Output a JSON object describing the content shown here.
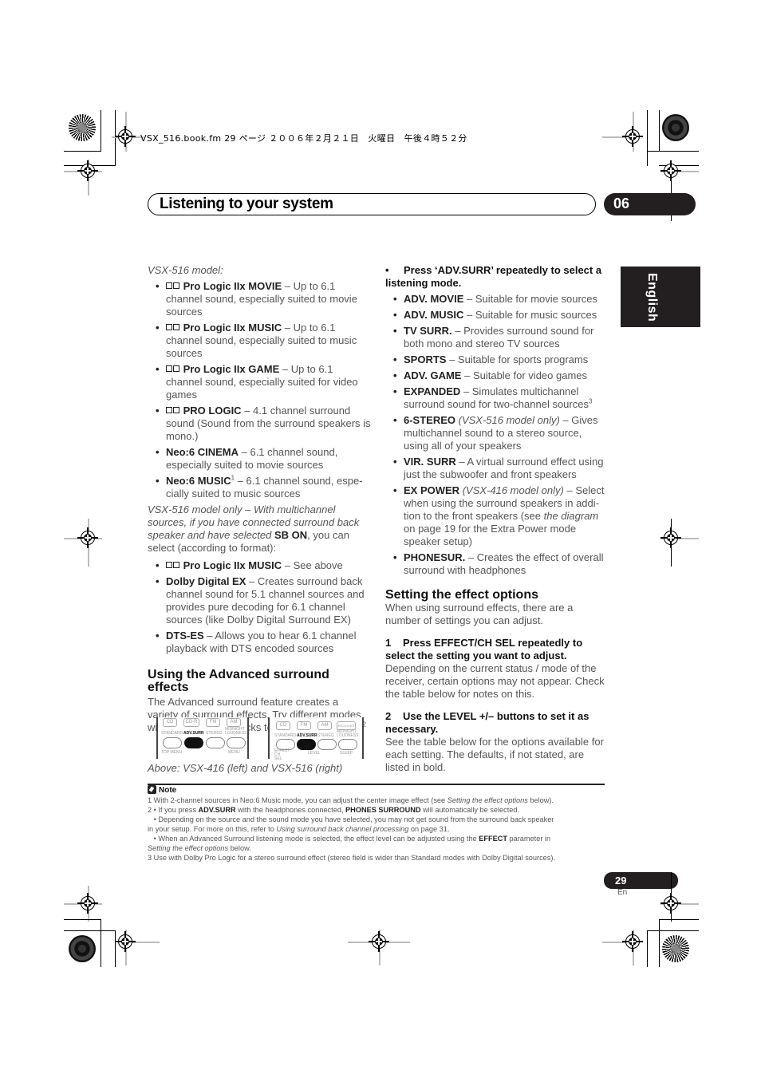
{
  "print_meta": "VSX_516.book.fm  29 ページ  ２００６年２月２１日　火曜日　午後４時５２分",
  "header": {
    "title": "Listening to your system",
    "chapter": "06"
  },
  "language_tab": "English",
  "left_column": {
    "intro_label": "VSX-516 model:",
    "modes": [
      {
        "name": "Pro Logic IIx MOVIE",
        "dolby_logo": true,
        "desc": " – Up to 6.1 channel sound, especially suited to movie sources"
      },
      {
        "name": "Pro Logic IIx MUSIC",
        "dolby_logo": true,
        "desc": " – Up to 6.1 channel sound, especially suited to music sources"
      },
      {
        "name": "Pro Logic IIx GAME",
        "dolby_logo": true,
        "desc": " – Up to 6.1 channel sound, especially suited for video games"
      },
      {
        "name": "PRO LOGIC",
        "dolby_logo": true,
        "desc": " – 4.1 channel surround sound (Sound from the surround speakers is mono.)"
      },
      {
        "name": "Neo:6 CINEMA",
        "dolby_logo": false,
        "desc": " – 6.1 channel sound, especially suited to movie sources"
      },
      {
        "name": "Neo:6 MUSIC",
        "dolby_logo": false,
        "sup": "1",
        "desc": " – 6.1 channel sound, espe-cially suited to music sources"
      }
    ],
    "sb_intro_italic": "VSX-516 model only – With multichannel sources, if you have connected surround back speaker and have selected ",
    "sb_intro_bold": "SB ON",
    "sb_intro_tail": ", you can select (according to format):",
    "sb_modes": [
      {
        "name": "Pro Logic IIx MUSIC",
        "dolby_logo": true,
        "desc": " – See above"
      },
      {
        "name": "Dolby Digital EX",
        "dolby_logo": false,
        "desc": " – Creates surround back channel sound for 5.1 channel sources and provides pure decoding for 6.1 channel sources (like Dolby Digital Surround EX)"
      },
      {
        "name": "DTS-ES",
        "dolby_logo": false,
        "desc": " – Allows you to hear 6.1 channel playback with DTS encoded sources"
      }
    ],
    "adv_heading": "Using the Advanced surround effects",
    "adv_body": "The Advanced surround feature creates a variety of surround effects. Try different modes with various soundtracks to see which you like.",
    "adv_body_sup": "2",
    "remote_416": {
      "top_buttons": [
        "CD",
        "CD-R",
        "FM",
        "AM"
      ],
      "labels": [
        "STANDARD",
        "ADV.SURR",
        "STEREO",
        "MIDNIGHT LOUDNESS"
      ],
      "bottom_labels": [
        "TOP MENU",
        "MENU"
      ]
    },
    "remote_516": {
      "top_buttons": [
        "CD",
        "FM",
        "AM",
        "RECEIVER"
      ],
      "labels": [
        "STANDARD",
        "ADV.SURR",
        "STEREO",
        "MIDNIGHT LOUDNESS"
      ],
      "bottom_labels": [
        "EFFECT CH SEL",
        "LEVEL",
        "SLEEP"
      ]
    },
    "caption": "Above: VSX-416 (left) and VSX-516 (right)"
  },
  "right_column": {
    "instruction": "Press ‘ADV.SURR’ repeatedly to select a listening mode.",
    "modes": [
      {
        "name": "ADV. MOVIE",
        "desc": " – Suitable for movie sources"
      },
      {
        "name": "ADV. MUSIC",
        "desc": " – Suitable for music sources"
      },
      {
        "name": "TV SURR.",
        "desc": " – Provides surround sound for both mono and stereo TV sources"
      },
      {
        "name": "SPORTS",
        "desc": " – Suitable for sports programs"
      },
      {
        "name": "ADV. GAME",
        "desc": " – Suitable for video games"
      },
      {
        "name": "EXPANDED",
        "desc": " – Simulates multichannel surround sound for two-channel sources",
        "sup": "3"
      },
      {
        "name": "6-STEREO",
        "italic": " (VSX-516 model only)",
        "desc": " – Gives multichannel sound to a stereo source, using all of your speakers"
      },
      {
        "name": "VIR. SURR",
        "desc": " – A virtual surround effect using just the subwoofer and front speakers"
      },
      {
        "name": "EX POWER",
        "italic": " (VSX-416 model only)",
        "desc": " – Select when using the surround speakers in addi-tion to the front speakers (see ",
        "desc_italic": "the diagram",
        "desc_tail": " on page 19 for the Extra Power mode speaker setup)"
      },
      {
        "name": "PHONESUR.",
        "desc": " – Creates the effect of overall surround with headphones"
      }
    ],
    "effect_heading": "Setting the effect options",
    "effect_body": "When using surround effects, there are a number of settings you can adjust.",
    "steps": [
      {
        "num": "1",
        "title": "Press EFFECT/CH SEL repeatedly to select the setting you want to adjust.",
        "body": "Depending on the current status / mode of the receiver, certain options may not appear. Check the table below for notes on this."
      },
      {
        "num": "2",
        "title": "Use the LEVEL +/– buttons to set it as necessary.",
        "body": "See the table below for the options available for each setting. The defaults, if not stated, are listed in bold."
      }
    ]
  },
  "notes": {
    "heading": "Note",
    "n1": {
      "pre": "1 With 2-channel sources in Neo:6 Music mode, you can adjust the center image effect (see ",
      "it": "Setting the effect options",
      "post": " below)."
    },
    "n2a": {
      "pre": "2 • If you press ",
      "b1": "ADV.SURR",
      "mid": " with the headphones connected, ",
      "b2": "PHONES SURROUND",
      "post": " will automatically be selected."
    },
    "n2b_line1": "   • Depending on the source and the sound mode you have selected, you may not get sound from the surround back speaker",
    "n2b_line2": {
      "pre": "in your setup. For more on this, refer to ",
      "it": "Using surround back channel processing",
      "post": " on page 31."
    },
    "n2c_line1": {
      "pre": "   • When an Advanced Surround listening mode is selected, the effect level can be adjusted using the ",
      "b": "EFFECT",
      "post": " parameter in"
    },
    "n2c_line2": {
      "it": "Setting the effect options",
      "post": " below."
    },
    "n3": "3 Use with Dolby Pro Logic for a stereo surround effect (stereo field is wider than Standard modes with Dolby Digital sources)."
  },
  "footer": {
    "page_number": "29",
    "language": "En"
  }
}
